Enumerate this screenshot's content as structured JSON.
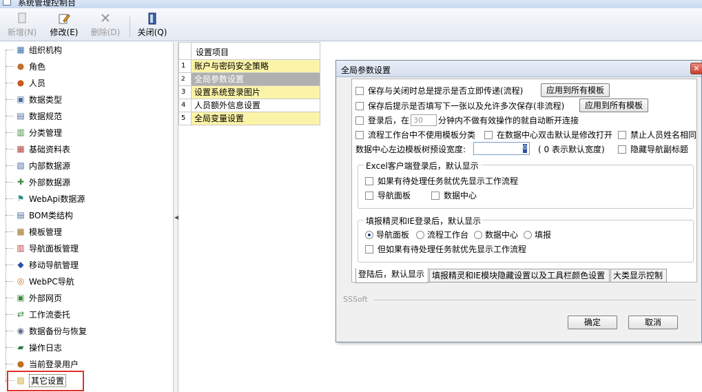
{
  "window": {
    "title": "系统管理控制台"
  },
  "toolbar": {
    "buttons": [
      {
        "label": "新增(N)",
        "icon": "new-document-icon",
        "disabled": true
      },
      {
        "label": "修改(E)",
        "icon": "edit-pencil-icon",
        "disabled": false
      },
      {
        "label": "删除(D)",
        "icon": "delete-x-icon",
        "disabled": true
      },
      {
        "label": "关闭(Q)",
        "icon": "door-exit-icon",
        "disabled": false
      }
    ]
  },
  "tree": {
    "items": [
      {
        "label": "组织机构",
        "icon": "org-chart-icon",
        "color": "#3a6fb0"
      },
      {
        "label": "角色",
        "icon": "role-users-icon",
        "color": "#c0702a"
      },
      {
        "label": "人员",
        "icon": "person-icon",
        "color": "#c85a20"
      },
      {
        "label": "数据类型",
        "icon": "data-type-icon",
        "color": "#4a6aa0"
      },
      {
        "label": "数据规范",
        "icon": "data-spec-icon",
        "color": "#4a6aa0"
      },
      {
        "label": "分类管理",
        "icon": "category-icon",
        "color": "#3a8a3a"
      },
      {
        "label": "基础资料表",
        "icon": "table-icon",
        "color": "#b04040"
      },
      {
        "label": "内部数据源",
        "icon": "internal-datasource-icon",
        "color": "#4a6aa0"
      },
      {
        "label": "外部数据源",
        "icon": "external-datasource-icon",
        "color": "#3a8a3a"
      },
      {
        "label": "WebApi数据源",
        "icon": "webapi-icon",
        "color": "#2a8a8a"
      },
      {
        "label": "BOM类结构",
        "icon": "bom-icon",
        "color": "#4a6aa0"
      },
      {
        "label": "模板管理",
        "icon": "template-icon",
        "color": "#a07020"
      },
      {
        "label": "导航面板管理",
        "icon": "nav-panel-icon",
        "color": "#b04040"
      },
      {
        "label": "移动导航管理",
        "icon": "mobile-nav-icon",
        "color": "#2a4fa8"
      },
      {
        "label": "WebPC导航",
        "icon": "webpc-nav-icon",
        "color": "#c07020"
      },
      {
        "label": "外部网页",
        "icon": "webpage-icon",
        "color": "#3a8a3a"
      },
      {
        "label": "工作流委托",
        "icon": "workflow-icon",
        "color": "#3a8a3a"
      },
      {
        "label": "数据备份与恢复",
        "icon": "backup-icon",
        "color": "#5a6a8a"
      },
      {
        "label": "操作日志",
        "icon": "log-book-icon",
        "color": "#2a7a4a"
      },
      {
        "label": "当前登录用户",
        "icon": "current-user-icon",
        "color": "#c07020"
      },
      {
        "label": "其它设置",
        "icon": "other-settings-icon",
        "color": "#c8a020"
      }
    ]
  },
  "grid": {
    "header": "设置项目",
    "rows": [
      {
        "num": "1",
        "label": "账户与密码安全策略",
        "selected": false,
        "bg": "#fbf3a8"
      },
      {
        "num": "2",
        "label": "全局参数设置",
        "selected": true,
        "bg": "#b0b0b0"
      },
      {
        "num": "3",
        "label": "设置系统登录图片",
        "selected": false,
        "bg": "#fbf3a8"
      },
      {
        "num": "4",
        "label": "人员额外信息设置",
        "selected": false,
        "bg": "#ffffff"
      },
      {
        "num": "5",
        "label": "全局变量设置",
        "selected": false,
        "bg": "#fbf3a8"
      }
    ]
  },
  "dialog": {
    "title": "全局参数设置",
    "opt_save_close_prompt": "保存与关闭时总是提示是否立即传递(流程)",
    "btn_apply_all_1": "应用到所有模板",
    "opt_save_next_prompt": "保存后提示是否填写下一张以及允许多次保存(非流程)",
    "btn_apply_all_2": "应用到所有模板",
    "opt_login_prefix": "登录后，在",
    "login_minutes": "30",
    "opt_login_suffix": "分钟内不做有效操作的就自动断开连接",
    "opt_no_template_category": "流程工作台中不使用模板分类",
    "opt_dblclick_edit": "在数据中心双击默认是修改打开",
    "opt_forbid_same_name": "禁止人员姓名相同",
    "tree_width_label": "数据中心左边模板树预设宽度:",
    "tree_width_value": "0",
    "tree_width_hint": "( 0 表示默认宽度)",
    "opt_hide_nav_subtitle": "隐藏导航副标题",
    "group_excel_title": "Excel客户端登录后，默认显示",
    "opt_excel_pending_first": "如果有待处理任务就优先显示工作流程",
    "opt_excel_nav_panel": "导航面板",
    "opt_excel_data_center": "数据中心",
    "group_ie_title": "填报精灵和IE登录后，默认显示",
    "radio_ie_nav_panel": "导航面板",
    "radio_ie_workflow": "流程工作台",
    "radio_ie_data_center": "数据中心",
    "radio_ie_fill": "填报",
    "opt_ie_pending_first": "但如果有待处理任务就优先显示工作流程",
    "tab_login_default": "登陆后，默认显示",
    "tab_hide_toolbar": "填报精灵和IE模块隐藏设置以及工具栏颜色设置",
    "tab_category_display": "大类显示控制",
    "footer_label": "SSSoft",
    "btn_ok": "确定",
    "btn_cancel": "取消",
    "close_glyph": "✕"
  }
}
